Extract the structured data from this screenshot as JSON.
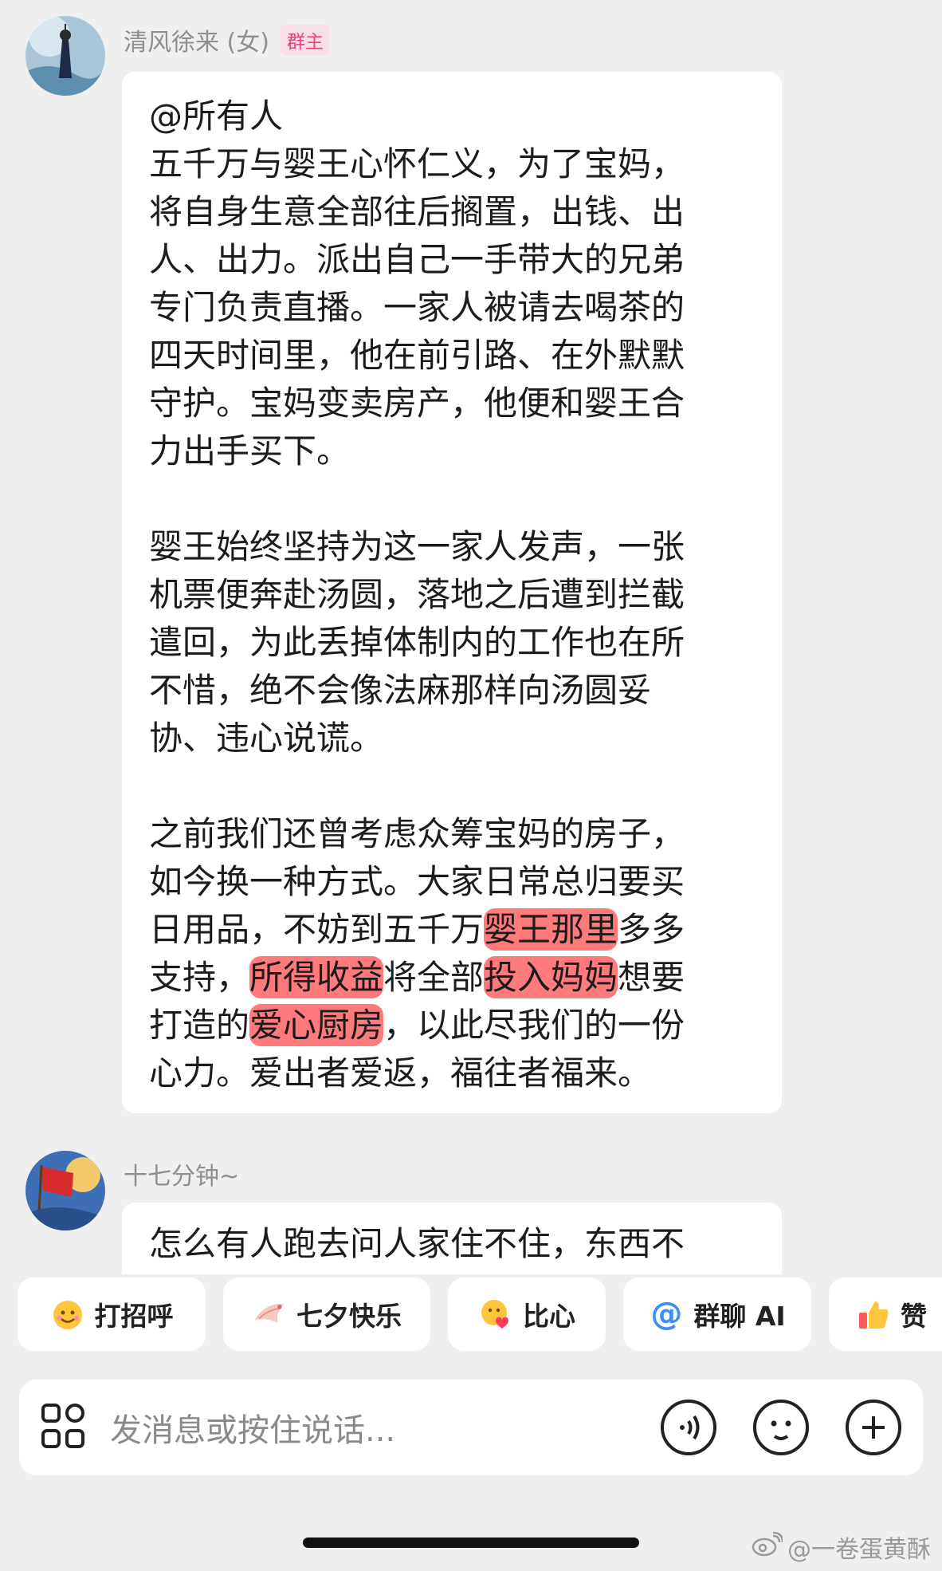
{
  "messages": [
    {
      "sender": "清风徐来 (女)",
      "badge": "群主",
      "paragraphs": [
        {
          "lines": [
            "@所有人",
            "五千万与婴王心怀仁义，为了宝妈，",
            "将自身生意全部往后搁置，出钱、出",
            "人、出力。派出自己一手带大的兄弟",
            "专门负责直播。一家人被请去喝茶的",
            "四天时间里，他在前引路、在外默默",
            "守护。宝妈变卖房产，他便和婴王合",
            "力出手买下。"
          ]
        },
        {
          "lines": [
            "婴王始终坚持为这一家人发声，一张",
            "机票便奔赴汤圆，落地之后遭到拦截",
            "遣回，为此丢掉体制内的工作也在所",
            "不惜，绝不会像法麻那样向汤圆妥",
            "协、违心说谎。"
          ]
        },
        {
          "lines": [
            "之前我们还曾考虑众筹宝妈的房子，",
            "如今换一种方式。大家日常总归要买"
          ],
          "line3": {
            "pre": "日用品，不妨到五千万",
            "hl": "婴王那里",
            "post": "多多"
          },
          "line4": {
            "pre": "支持，",
            "hl1": "所得收益",
            "mid": "将全部",
            "hl2": "投入妈妈",
            "post": "想要"
          },
          "line5": {
            "pre": "打造的",
            "hl": "爱心厨房",
            "post": "，以此尽我们的一份"
          },
          "line6": "心力。爱出者爱返，福往者福来。"
        }
      ]
    },
    {
      "sender": "十七分钟~",
      "text": "怎么有人跑去问人家住不住，东西不"
    }
  ],
  "quick_replies": [
    "打招呼",
    "七夕快乐",
    "比心",
    "群聊 AI",
    "赞"
  ],
  "input": {
    "placeholder": "发消息或按住说话..."
  },
  "watermark": "@一卷蛋黄酥",
  "colors": {
    "highlight": "#ff4848",
    "badge_text": "#e0467c",
    "background": "#efefef"
  }
}
